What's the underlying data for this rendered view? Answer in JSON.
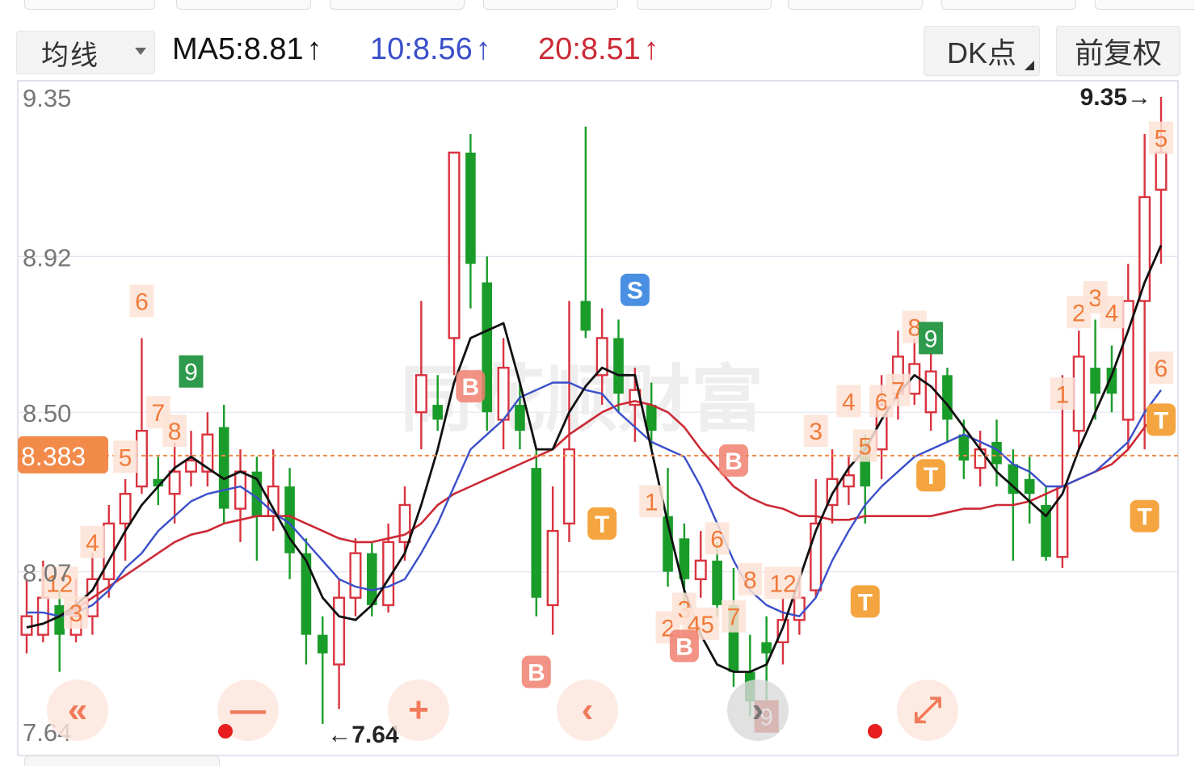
{
  "toolbar": {
    "ma_select_label": "均线",
    "ma5_label": "MA5:8.81",
    "ma10_label": "10:8.56",
    "ma20_label": "20:8.51",
    "arrow_up": "↑",
    "dk_label": "DK点",
    "adjust_label": "前复权"
  },
  "colors": {
    "up": "#d9333f",
    "down": "#1a9c2a",
    "ma5": "#111111",
    "ma10": "#3a4fc9",
    "ma20": "#cc2a35",
    "label_orange": "#f07a3a",
    "label_green": "#2e9a4c",
    "buy_sell_red": "#f08070",
    "t_orange": "#f5a540",
    "s_blue": "#4a90e2",
    "current_price_bg": "#f28a4a"
  },
  "chart_data": {
    "type": "candlestick",
    "y_ticks": [
      "9.35",
      "8.92",
      "8.50",
      "8.07",
      "7.64"
    ],
    "y_tick_values": [
      9.35,
      8.92,
      8.5,
      8.07,
      7.64
    ],
    "ylim": [
      7.64,
      9.35
    ],
    "current_price": "8.383",
    "current_price_value": 8.383,
    "high_marker": "9.35→",
    "low_marker": "←7.64",
    "candles": [
      [
        7.9,
        7.95,
        8.05,
        7.85
      ],
      [
        7.9,
        8.0,
        8.1,
        7.88
      ],
      [
        7.98,
        7.9,
        8.02,
        7.8
      ],
      [
        7.9,
        7.95,
        8.05,
        7.88
      ],
      [
        7.95,
        8.05,
        8.12,
        7.9
      ],
      [
        8.05,
        8.2,
        8.25,
        8.0
      ],
      [
        8.2,
        8.28,
        8.32,
        8.1
      ],
      [
        8.3,
        8.45,
        8.7,
        8.28
      ],
      [
        8.32,
        8.3,
        8.38,
        8.25
      ],
      [
        8.28,
        8.34,
        8.42,
        8.2
      ],
      [
        8.34,
        8.37,
        8.45,
        8.3
      ],
      [
        8.34,
        8.44,
        8.5,
        8.3
      ],
      [
        8.46,
        8.24,
        8.52,
        8.2
      ],
      [
        8.24,
        8.34,
        8.4,
        8.15
      ],
      [
        8.34,
        8.22,
        8.38,
        8.1
      ],
      [
        8.22,
        8.3,
        8.4,
        8.18
      ],
      [
        8.3,
        8.12,
        8.35,
        8.05
      ],
      [
        8.12,
        7.9,
        8.16,
        7.82
      ],
      [
        7.9,
        7.85,
        7.95,
        7.66
      ],
      [
        7.82,
        8.0,
        8.05,
        7.7
      ],
      [
        8.0,
        8.12,
        8.16,
        7.95
      ],
      [
        8.12,
        7.98,
        8.15,
        7.95
      ],
      [
        7.98,
        8.15,
        8.2,
        7.96
      ],
      [
        8.15,
        8.25,
        8.3,
        8.1
      ],
      [
        8.5,
        8.6,
        8.8,
        8.4
      ],
      [
        8.52,
        8.48,
        8.6,
        8.45
      ],
      [
        8.7,
        9.2,
        9.2,
        8.6
      ],
      [
        9.2,
        8.9,
        9.25,
        8.78
      ],
      [
        8.85,
        8.5,
        8.92,
        8.45
      ],
      [
        8.48,
        8.62,
        8.7,
        8.4
      ],
      [
        8.52,
        8.45,
        8.58,
        8.4
      ],
      [
        8.35,
        8.0,
        8.4,
        7.95
      ],
      [
        7.98,
        8.18,
        8.3,
        7.9
      ],
      [
        8.2,
        8.4,
        8.8,
        8.15
      ],
      [
        8.8,
        8.72,
        9.27,
        8.7
      ],
      [
        8.6,
        8.7,
        8.78,
        8.52
      ],
      [
        8.7,
        8.55,
        8.75,
        8.5
      ],
      [
        8.52,
        8.56,
        8.62,
        8.42
      ],
      [
        8.52,
        8.45,
        8.58,
        8.4
      ],
      [
        8.22,
        8.07,
        8.35,
        8.03
      ],
      [
        8.16,
        8.05,
        8.2,
        7.98
      ],
      [
        8.05,
        8.1,
        8.18,
        8.0
      ],
      [
        8.1,
        7.98,
        8.15,
        7.95
      ],
      [
        7.98,
        7.8,
        8.08,
        7.76
      ],
      [
        7.8,
        7.72,
        7.9,
        7.68
      ],
      [
        7.88,
        7.85,
        7.95,
        7.7
      ],
      [
        7.88,
        7.94,
        8.0,
        7.82
      ],
      [
        7.94,
        8.0,
        8.05,
        7.9
      ],
      [
        8.02,
        8.2,
        8.32,
        8.0
      ],
      [
        8.25,
        8.32,
        8.4,
        8.2
      ],
      [
        8.3,
        8.33,
        8.38,
        8.25
      ],
      [
        8.42,
        8.3,
        8.44,
        8.2
      ],
      [
        8.4,
        8.52,
        8.6,
        8.32
      ],
      [
        8.55,
        8.65,
        8.72,
        8.48
      ],
      [
        8.55,
        8.63,
        8.7,
        8.52
      ],
      [
        8.5,
        8.61,
        8.66,
        8.45
      ],
      [
        8.6,
        8.48,
        8.62,
        8.42
      ],
      [
        8.44,
        8.37,
        8.48,
        8.32
      ],
      [
        8.35,
        8.4,
        8.45,
        8.3
      ],
      [
        8.42,
        8.36,
        8.48,
        8.3
      ],
      [
        8.36,
        8.28,
        8.4,
        8.1
      ],
      [
        8.32,
        8.28,
        8.38,
        8.2
      ],
      [
        8.25,
        8.11,
        8.3,
        8.1
      ],
      [
        8.11,
        8.3,
        8.6,
        8.08
      ],
      [
        8.45,
        8.65,
        8.72,
        8.4
      ],
      [
        8.62,
        8.55,
        8.75,
        8.48
      ],
      [
        8.62,
        8.55,
        8.68,
        8.5
      ],
      [
        8.48,
        8.8,
        8.9,
        8.4
      ],
      [
        8.8,
        9.08,
        9.25,
        8.4
      ],
      [
        9.1,
        9.2,
        9.35,
        8.9
      ]
    ],
    "ma5": [
      7.92,
      7.93,
      7.95,
      7.98,
      8.02,
      8.1,
      8.18,
      8.25,
      8.3,
      8.35,
      8.38,
      8.35,
      8.32,
      8.34,
      8.32,
      8.24,
      8.16,
      8.1,
      8.0,
      7.95,
      7.94,
      7.98,
      8.05,
      8.12,
      8.25,
      8.4,
      8.58,
      8.7,
      8.72,
      8.74,
      8.58,
      8.4,
      8.4,
      8.5,
      8.57,
      8.62,
      8.6,
      8.6,
      8.4,
      8.2,
      8.02,
      7.9,
      7.82,
      7.8,
      7.8,
      7.82,
      7.92,
      8.05,
      8.18,
      8.28,
      8.35,
      8.4,
      8.48,
      8.55,
      8.6,
      8.57,
      8.52,
      8.46,
      8.4,
      8.34,
      8.3,
      8.26,
      8.22,
      8.28,
      8.4,
      8.5,
      8.6,
      8.72,
      8.85,
      8.95
    ],
    "ma10": [
      7.96,
      7.96,
      7.95,
      7.96,
      7.98,
      8.02,
      8.08,
      8.12,
      8.18,
      8.22,
      8.26,
      8.28,
      8.29,
      8.3,
      8.27,
      8.23,
      8.2,
      8.15,
      8.1,
      8.05,
      8.03,
      8.02,
      8.03,
      8.05,
      8.12,
      8.2,
      8.3,
      8.4,
      8.44,
      8.48,
      8.54,
      8.56,
      8.58,
      8.58,
      8.56,
      8.55,
      8.5,
      8.46,
      8.42,
      8.4,
      8.38,
      8.3,
      8.2,
      8.1,
      8.02,
      7.98,
      7.96,
      7.95,
      8.0,
      8.1,
      8.18,
      8.25,
      8.3,
      8.34,
      8.38,
      8.4,
      8.42,
      8.44,
      8.42,
      8.4,
      8.36,
      8.34,
      8.3,
      8.3,
      8.32,
      8.34,
      8.38,
      8.42,
      8.5,
      8.56
    ],
    "ma20": [
      7.92,
      7.93,
      7.95,
      7.97,
      8.0,
      8.03,
      8.06,
      8.09,
      8.12,
      8.15,
      8.17,
      8.18,
      8.2,
      8.21,
      8.22,
      8.22,
      8.22,
      8.2,
      8.18,
      8.16,
      8.15,
      8.15,
      8.16,
      8.17,
      8.2,
      8.25,
      8.28,
      8.3,
      8.32,
      8.34,
      8.36,
      8.38,
      8.4,
      8.44,
      8.47,
      8.5,
      8.52,
      8.53,
      8.52,
      8.5,
      8.46,
      8.4,
      8.35,
      8.3,
      8.27,
      8.25,
      8.24,
      8.22,
      8.22,
      8.21,
      8.21,
      8.22,
      8.22,
      8.22,
      8.22,
      8.22,
      8.23,
      8.24,
      8.24,
      8.25,
      8.25,
      8.26,
      8.28,
      8.3,
      8.32,
      8.34,
      8.36,
      8.4,
      8.46,
      8.51
    ],
    "count_labels": [
      {
        "text": "12",
        "i": 2,
        "p": 8.04,
        "c": "orange"
      },
      {
        "text": "3",
        "i": 3,
        "p": 7.96,
        "c": "orange"
      },
      {
        "text": "4",
        "i": 4,
        "p": 8.15,
        "c": "orange"
      },
      {
        "text": "6",
        "i": 7,
        "p": 8.8,
        "c": "orange"
      },
      {
        "text": "5",
        "i": 6,
        "p": 8.38,
        "c": "orange"
      },
      {
        "text": "7",
        "i": 8,
        "p": 8.5,
        "c": "orange"
      },
      {
        "text": "8",
        "i": 9,
        "p": 8.45,
        "c": "orange"
      },
      {
        "text": "9",
        "i": 10,
        "p": 8.61,
        "c": "green"
      },
      {
        "text": "1",
        "i": 38,
        "p": 8.26,
        "c": "orange"
      },
      {
        "text": "6",
        "i": 42,
        "p": 8.16,
        "c": "orange"
      },
      {
        "text": "2",
        "i": 39,
        "p": 7.92,
        "c": "orange"
      },
      {
        "text": "3",
        "i": 40,
        "p": 7.97,
        "c": "orange"
      },
      {
        "text": "45",
        "i": 41,
        "p": 7.93,
        "c": "orange"
      },
      {
        "text": "7",
        "i": 43,
        "p": 7.95,
        "c": "orange"
      },
      {
        "text": "8",
        "i": 44,
        "p": 8.05,
        "c": "orange"
      },
      {
        "text": "12",
        "i": 46,
        "p": 8.04,
        "c": "orange"
      },
      {
        "text": "9",
        "i": 45,
        "p": 7.68,
        "c": "red"
      },
      {
        "text": "3",
        "i": 48,
        "p": 8.45,
        "c": "orange"
      },
      {
        "text": "4",
        "i": 50,
        "p": 8.53,
        "c": "orange"
      },
      {
        "text": "5",
        "i": 51,
        "p": 8.41,
        "c": "orange"
      },
      {
        "text": "6",
        "i": 52,
        "p": 8.53,
        "c": "orange"
      },
      {
        "text": "7",
        "i": 53,
        "p": 8.56,
        "c": "orange"
      },
      {
        "text": "8",
        "i": 54,
        "p": 8.73,
        "c": "orange"
      },
      {
        "text": "9",
        "i": 55,
        "p": 8.7,
        "c": "green"
      },
      {
        "text": "1",
        "i": 63,
        "p": 8.55,
        "c": "orange"
      },
      {
        "text": "2",
        "i": 64,
        "p": 8.77,
        "c": "orange"
      },
      {
        "text": "3",
        "i": 65,
        "p": 8.81,
        "c": "orange"
      },
      {
        "text": "4",
        "i": 66,
        "p": 8.77,
        "c": "orange"
      },
      {
        "text": "5",
        "i": 69,
        "p": 9.24,
        "c": "orange"
      },
      {
        "text": "6",
        "i": 69,
        "p": 8.62,
        "c": "orange"
      }
    ],
    "signals": [
      {
        "text": "B",
        "i": 27,
        "p": 8.57,
        "kind": "B"
      },
      {
        "text": "B",
        "i": 31,
        "p": 7.8,
        "kind": "B"
      },
      {
        "text": "T",
        "i": 35,
        "p": 8.2,
        "kind": "T"
      },
      {
        "text": "S",
        "i": 37,
        "p": 8.83,
        "kind": "S"
      },
      {
        "text": "B",
        "i": 43,
        "p": 8.37,
        "kind": "B"
      },
      {
        "text": "B",
        "i": 40,
        "p": 7.87,
        "kind": "B"
      },
      {
        "text": "T",
        "i": 51,
        "p": 7.99,
        "kind": "T"
      },
      {
        "text": "T",
        "i": 55,
        "p": 8.33,
        "kind": "T"
      },
      {
        "text": "T",
        "i": 69,
        "p": 8.48,
        "kind": "T"
      },
      {
        "text": "T",
        "i": 68,
        "p": 8.22,
        "kind": "T"
      }
    ],
    "watermark": "同花顺财富"
  },
  "nav_buttons": {
    "rewind": "«",
    "zoom_out": "—",
    "zoom_in": "+",
    "prev": "‹",
    "next": "›",
    "fullscreen": "⤢"
  }
}
